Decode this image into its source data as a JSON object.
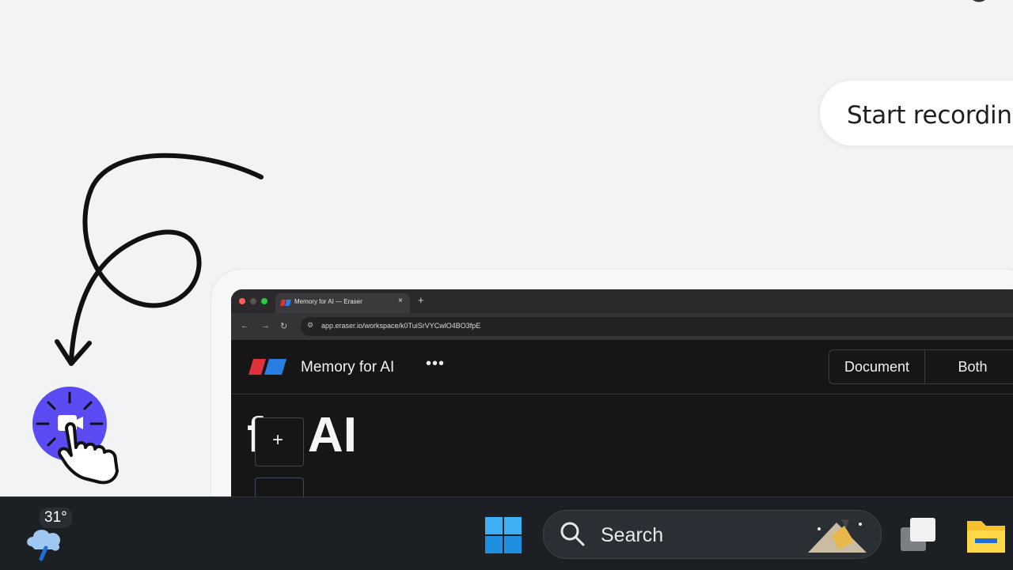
{
  "recording_prompt": {
    "label": "Start recording"
  },
  "preview": {
    "tab_title": "Memory for AI — Eraser",
    "tab_close": "×",
    "new_tab": "+",
    "url": "app.eraser.io/workspace/k0TuiSrVYCwlO4BO3fpE",
    "app": {
      "title": "Memory for AI",
      "more": "•••",
      "view_toggle": {
        "document": "Document",
        "both": "Both"
      },
      "heading": "f   r AI",
      "add_block": "+"
    }
  },
  "taskbar": {
    "weather": {
      "temperature": "31°",
      "icon": "cloud-rain-icon"
    },
    "search": {
      "placeholder": "Search"
    }
  },
  "colors": {
    "record_button": "#5a4bf3",
    "taskbar": "#1c1f24",
    "background": "#f2f3f5"
  }
}
